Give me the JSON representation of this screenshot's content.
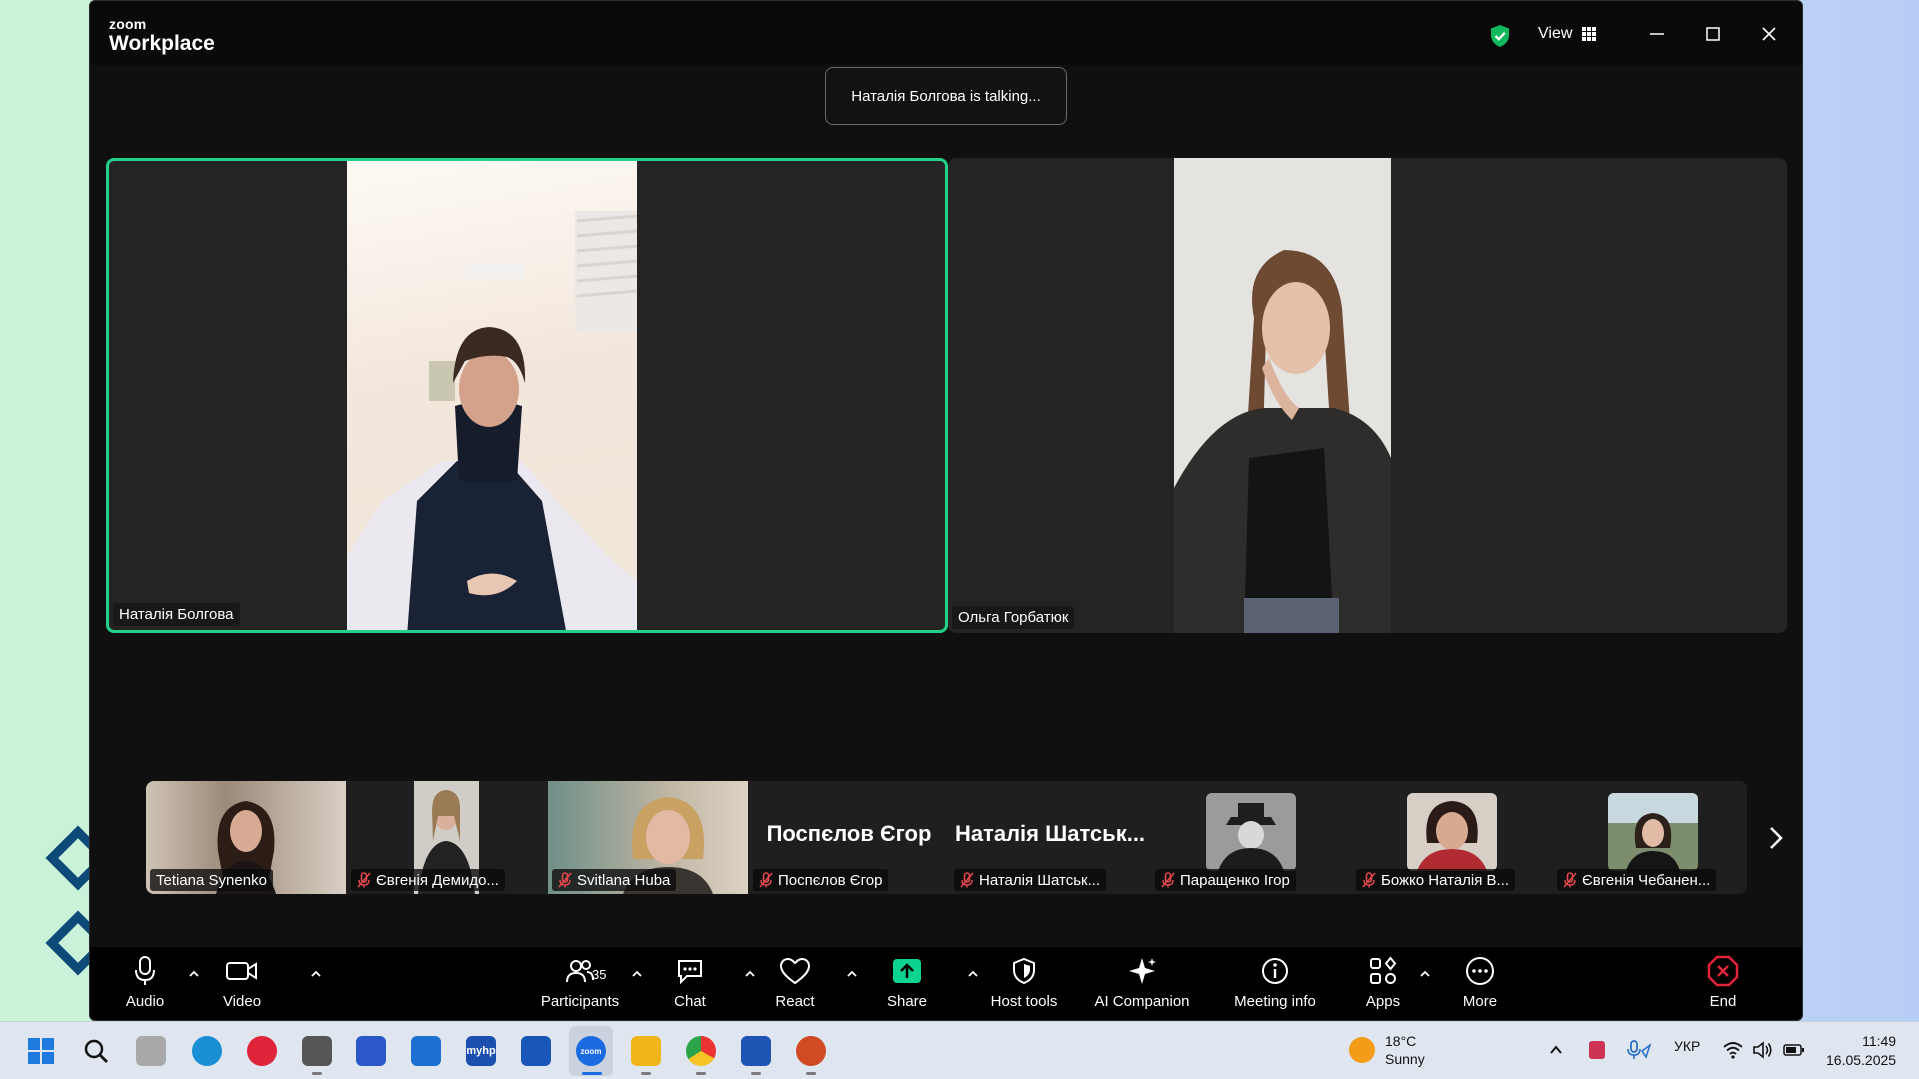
{
  "app": {
    "logo_small": "zoom",
    "logo_big": "Workplace",
    "view_label": "View"
  },
  "meeting": {
    "talking_banner": "Наталія Болгова is talking...",
    "active_border_color": "#23d18b",
    "main_tiles": [
      {
        "name": "Наталія Болгова"
      },
      {
        "name": "Ольга Горбатюк"
      }
    ],
    "filmstrip": [
      {
        "name": "Tetiana Synenko",
        "muted": false
      },
      {
        "name": "Євгенія Демидо...",
        "muted": true
      },
      {
        "name": "Svitlana Huba",
        "muted": true
      },
      {
        "name": "Поспєлов Єгор",
        "big_name": "Поспєлов Єгор",
        "muted": true
      },
      {
        "name": "Наталія Шатськ...",
        "big_name": "Наталія Шатськ...",
        "muted": true
      },
      {
        "name": "Паращенко Ігор",
        "muted": true
      },
      {
        "name": "Божко Наталія В...",
        "muted": true
      },
      {
        "name": "Євгенія Чебанен...",
        "muted": true
      }
    ]
  },
  "toolbar": {
    "audio": "Audio",
    "video": "Video",
    "participants": "Participants",
    "participants_count": "35",
    "chat": "Chat",
    "react": "React",
    "share": "Share",
    "host_tools": "Host tools",
    "ai_companion": "AI Companion",
    "meeting_info": "Meeting info",
    "apps": "Apps",
    "more": "More",
    "end": "End",
    "share_color": "#0bd48f",
    "end_color": "#e0243a"
  },
  "taskbar": {
    "weather_temp": "18°C",
    "weather_desc": "Sunny",
    "language": "УКР",
    "time": "11:49",
    "date": "16.05.2025",
    "app_labels": {
      "myhp": "myhp",
      "zoom": "zoom"
    }
  }
}
